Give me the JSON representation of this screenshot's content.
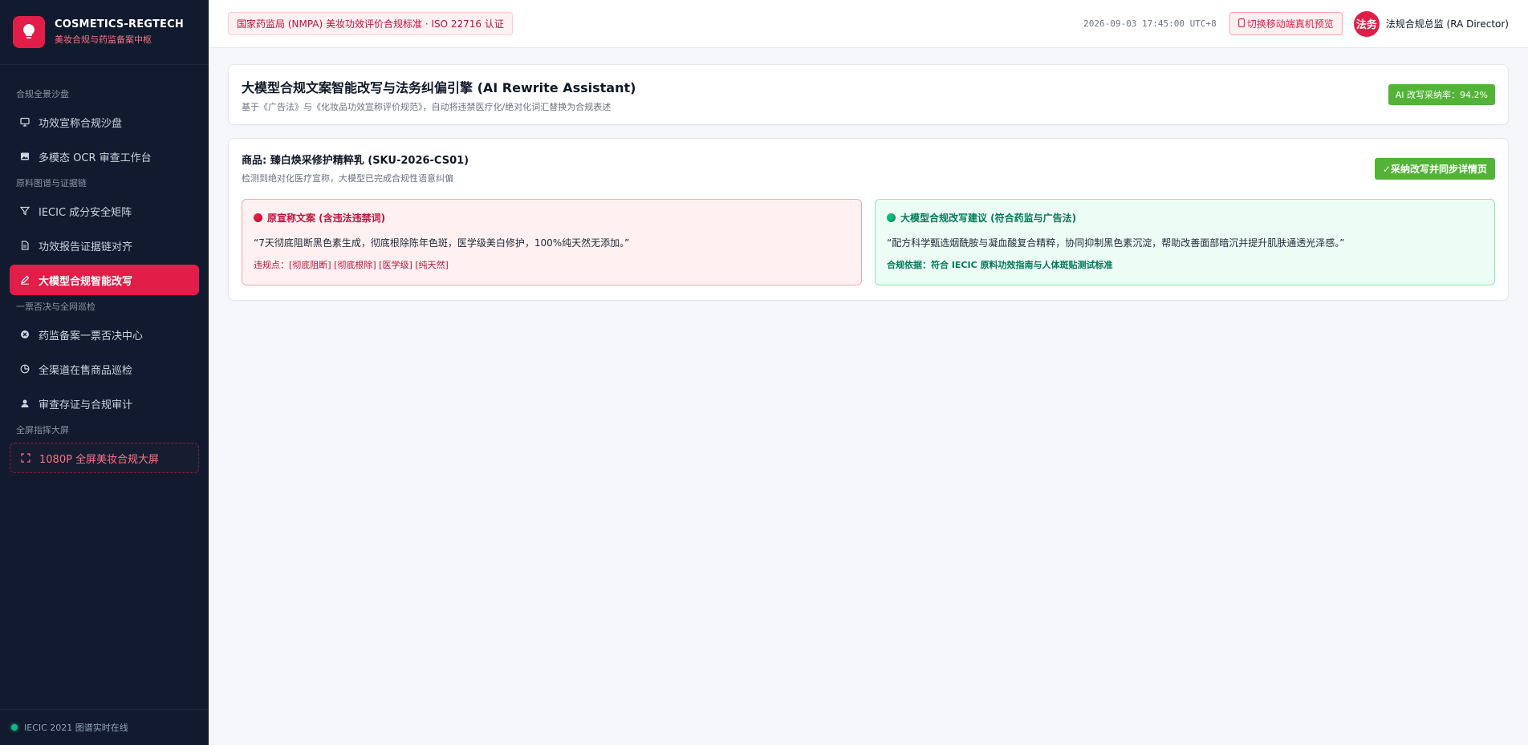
{
  "brand": {
    "title": "COSMETICS-REGTECH",
    "subtitle": "美妆合规与药监备案中枢",
    "logo_icon": "lightbulb-icon"
  },
  "sidebar": {
    "groups": [
      {
        "label": "合规全景沙盘"
      },
      {
        "label": "原料图谱与证据链"
      },
      {
        "label": "一票否决与全网巡检"
      },
      {
        "label": "全屏指挥大屏"
      }
    ],
    "items": [
      {
        "label": "功效宣称合规沙盘",
        "icon": "monitor-icon"
      },
      {
        "label": "多模态 OCR 审查工作台",
        "icon": "image-icon"
      },
      {
        "label": "IECIC 成分安全矩阵",
        "icon": "filter-icon"
      },
      {
        "label": "功效报告证据链对齐",
        "icon": "document-icon"
      },
      {
        "label": "大模型合规智能改写",
        "icon": "pen-icon"
      },
      {
        "label": "药监备案一票否决中心",
        "icon": "cancel-circle-icon"
      },
      {
        "label": "全渠道在售商品巡检",
        "icon": "pie-chart-icon"
      },
      {
        "label": "审查存证与合规审计",
        "icon": "user-icon"
      },
      {
        "label": "1080P 全屏美妆合规大屏",
        "icon": "fullscreen-icon"
      }
    ],
    "active_index": 4,
    "footer": "IECIC 2021 图谱实时在线"
  },
  "topbar": {
    "reg_badge": "国家药监局 (NMPA) 美妆功效评价合规标准 · ISO 22716 认证",
    "timestamp": "2026-09-03 17:45:00 UTC+8",
    "mobile_button": "切换移动端真机预览",
    "avatar_text": "法务",
    "user_name": "法规合规总监 (RA Director)"
  },
  "header": {
    "title": "大模型合规文案智能改写与法务纠偏引擎 (AI Rewrite Assistant)",
    "subtitle": "基于《广告法》与《化妆品功效宣称评价规范》，自动将违禁医疗化/绝对化词汇替换为合规表述",
    "rate_badge": "AI 改写采纳率：94.2%"
  },
  "product": {
    "title": "商品: 臻白焕采修护精粹乳 (SKU-2026-CS01)",
    "subtitle": "检测到绝对化医疗宣称，大模型已完成合规性语意纠偏",
    "adopt_button": "采纳改写并同步详情页",
    "original": {
      "title": "原宣称文案 (含违法违禁词)",
      "text": "“7天彻底阻断黑色素生成，彻底根除陈年色斑，医学级美白修护，100%纯天然无添加。”",
      "note": "违规点：[彻底阻断] [彻底根除] [医学级] [纯天然]"
    },
    "rewrite": {
      "title": "大模型合规改写建议 (符合药监与广告法)",
      "text": "“配方科学甄选烟酰胺与凝血酸复合精粹，协同抑制黑色素沉淀，帮助改善面部暗沉并提升肌肤通透光泽感。”",
      "note": "合规依据：符合 IECIC 原料功效指南与人体斑贴测试标准"
    }
  },
  "colors": {
    "sidebar_bg": "#111a2e",
    "accent": "#e11d48",
    "success": "#52b338"
  }
}
